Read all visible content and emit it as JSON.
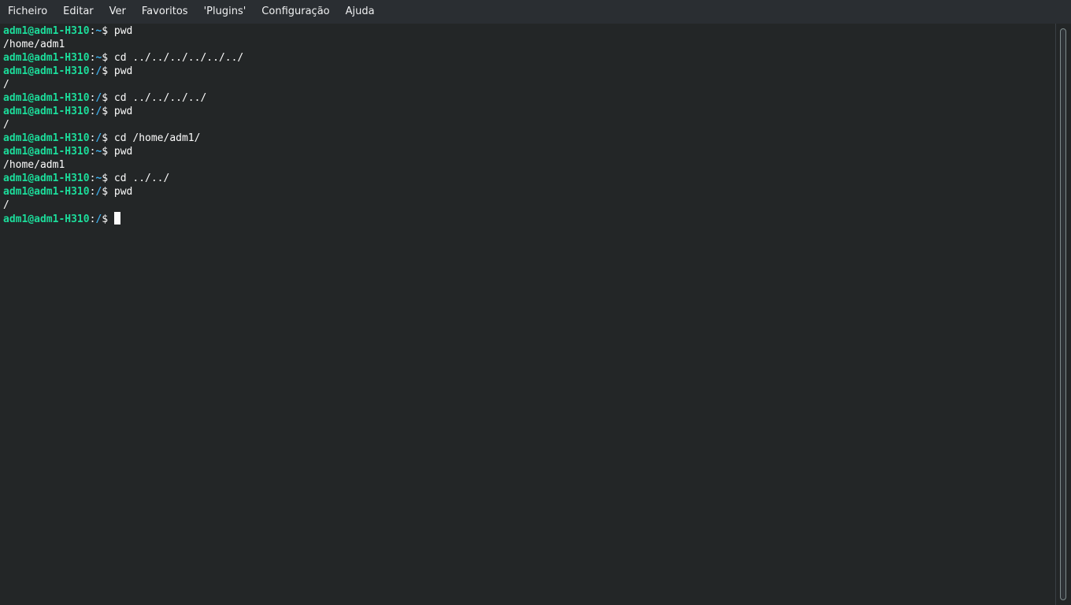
{
  "menubar": {
    "items": [
      "Ficheiro",
      "Editar",
      "Ver",
      "Favoritos",
      "'Plugins'",
      "Configuração",
      "Ajuda"
    ]
  },
  "terminal": {
    "lines": [
      {
        "type": "prompt",
        "user": "adm1@adm1-H310",
        "path": "~",
        "symbol": "$ ",
        "command": "pwd"
      },
      {
        "type": "output",
        "text": "/home/adm1"
      },
      {
        "type": "prompt",
        "user": "adm1@adm1-H310",
        "path": "~",
        "symbol": "$ ",
        "command": "cd ../../../../../../"
      },
      {
        "type": "prompt",
        "user": "adm1@adm1-H310",
        "path": "/",
        "symbol": "$ ",
        "command": "pwd"
      },
      {
        "type": "output",
        "text": "/"
      },
      {
        "type": "prompt",
        "user": "adm1@adm1-H310",
        "path": "/",
        "symbol": "$ ",
        "command": "cd ../../../../"
      },
      {
        "type": "prompt",
        "user": "adm1@adm1-H310",
        "path": "/",
        "symbol": "$ ",
        "command": "pwd"
      },
      {
        "type": "output",
        "text": "/"
      },
      {
        "type": "prompt",
        "user": "adm1@adm1-H310",
        "path": "/",
        "symbol": "$ ",
        "command": "cd /home/adm1/"
      },
      {
        "type": "prompt",
        "user": "adm1@adm1-H310",
        "path": "~",
        "symbol": "$ ",
        "command": "pwd"
      },
      {
        "type": "output",
        "text": "/home/adm1"
      },
      {
        "type": "prompt",
        "user": "adm1@adm1-H310",
        "path": "~",
        "symbol": "$ ",
        "command": "cd ../../"
      },
      {
        "type": "prompt",
        "user": "adm1@adm1-H310",
        "path": "/",
        "symbol": "$ ",
        "command": "pwd"
      },
      {
        "type": "output",
        "text": "/"
      },
      {
        "type": "prompt",
        "user": "adm1@adm1-H310",
        "path": "/",
        "symbol": "$ ",
        "command": "",
        "cursor": true
      }
    ]
  },
  "colors": {
    "user": "#1cdc9a",
    "path": "#3daee9",
    "background": "#232627",
    "foreground": "#fcfcfc"
  }
}
